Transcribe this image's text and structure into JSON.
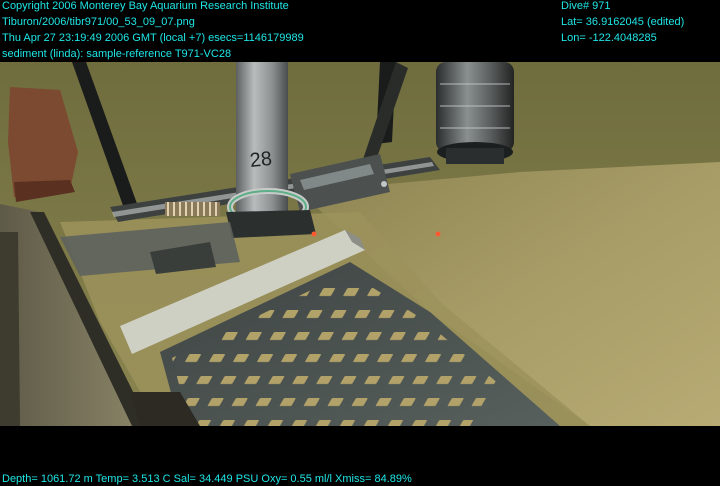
{
  "overlay": {
    "top_left": [
      "Copyright 2006 Monterey Bay Aquarium Research Institute",
      "Tiburon/2006/tibr971/00_53_09_07.png",
      "Thu Apr 27 23:19:49 2006 GMT (local +7)  esecs=1146179989",
      "sediment (linda): sample-reference T971-VC28"
    ],
    "top_right": [
      "Dive# 971",
      "Lat= 36.9162045 (edited)",
      "Lon= -122.4048285"
    ],
    "bottom": "Depth= 1061.72 m  Temp= 3.513 C  Sal= 34.449 PSU  Oxy= 0.55 ml/l  Xmiss= 84.89%"
  },
  "scene": {
    "tube_label": "28",
    "colors": {
      "sediment": "#a89a62",
      "water": "#7d7a4a",
      "metal": "#4a4d4d",
      "overlay_text": "#1fe6e6"
    }
  }
}
